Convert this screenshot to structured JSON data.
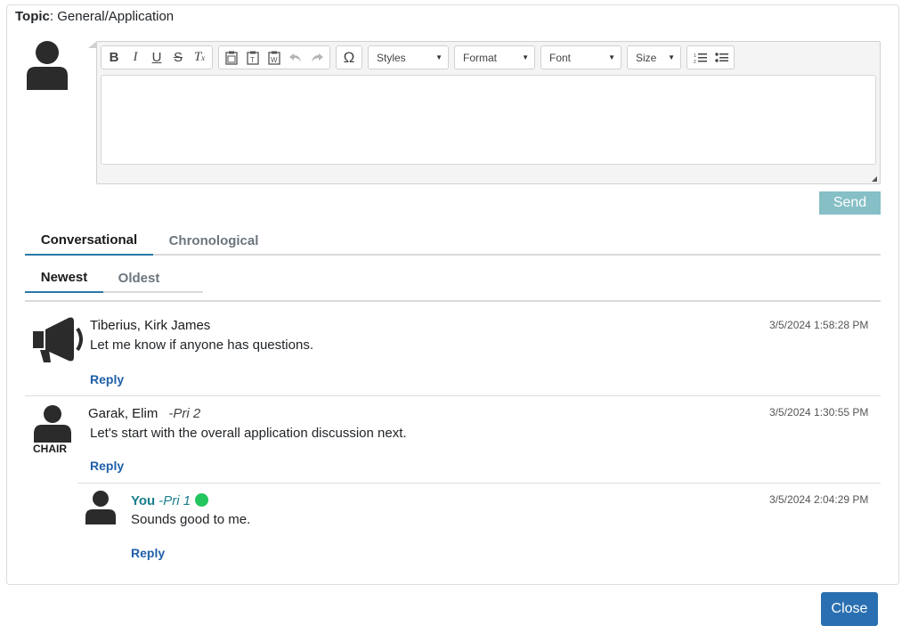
{
  "topic": {
    "label": "Topic",
    "value": "General/Application"
  },
  "toolbar": {
    "styles_label": "Styles",
    "format_label": "Format",
    "font_label": "Font",
    "size_label": "Size"
  },
  "send_label": "Send",
  "view_tabs": [
    {
      "label": "Conversational",
      "active": true
    },
    {
      "label": "Chronological",
      "active": false
    }
  ],
  "sort_tabs": [
    {
      "label": "Newest",
      "active": true
    },
    {
      "label": "Oldest",
      "active": false
    }
  ],
  "messages": [
    {
      "author": "Tiberius, Kirk James",
      "priority": "",
      "text": "Let me know if anyone has questions.",
      "timestamp": "3/5/2024 1:58:28 PM",
      "reply_label": "Reply",
      "icon": "megaphone-icon"
    },
    {
      "author": "Garak, Elim",
      "priority": "-Pri 2",
      "role": "CHAIR",
      "text": "Let's start with the overall application discussion next.",
      "timestamp": "3/5/2024 1:30:55 PM",
      "reply_label": "Reply",
      "icon": "user-icon"
    },
    {
      "author": "You",
      "priority": "-Pri 1",
      "text": "Sounds good to me.",
      "timestamp": "3/5/2024 2:04:29 PM",
      "reply_label": "Reply",
      "icon": "user-icon",
      "online": true
    }
  ],
  "close_label": "Close",
  "colors": {
    "send_button": "#86bfc6",
    "close_button": "#2a6fb1",
    "active_tab_underline": "#2a78a8",
    "reply_link": "#1f5fa8",
    "you_name": "#1a7f8e",
    "online_dot": "#22c55e"
  }
}
